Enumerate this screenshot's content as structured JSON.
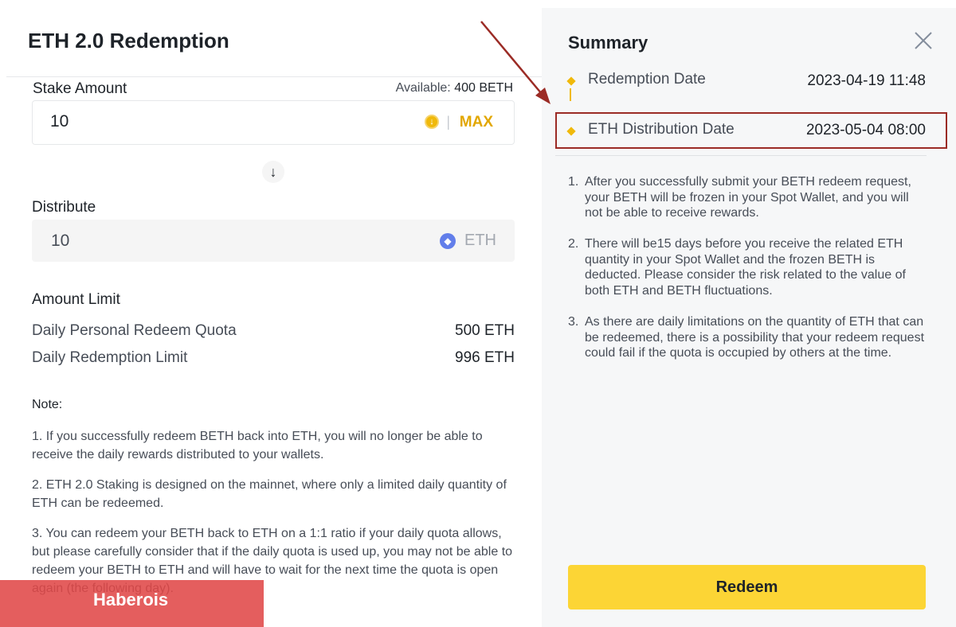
{
  "left": {
    "title": "ETH 2.0 Redemption",
    "stake": {
      "label": "Stake Amount",
      "available_label": "Available:",
      "available_value": "400 BETH",
      "input_value": "10",
      "max_label": "MAX",
      "separator": "|"
    },
    "swap_arrow": "↓",
    "distribute": {
      "label": "Distribute",
      "value": "10",
      "unit": "ETH"
    },
    "amount_limit": {
      "title": "Amount Limit",
      "rows": [
        {
          "label": "Daily Personal Redeem Quota",
          "value": "500 ETH"
        },
        {
          "label": "Daily Redemption Limit",
          "value": "996 ETH"
        }
      ]
    },
    "note": {
      "title": "Note:",
      "items": [
        "1. If you successfully redeem BETH back into ETH, you will no longer be able to receive the daily rewards distributed to your wallets.",
        "2. ETH 2.0 Staking is designed on the mainnet, where only a limited daily quantity of ETH can be redeemed.",
        "3. You can redeem your BETH back to ETH on a 1:1 ratio if your daily quota allows, but please carefully consider that if the daily quota is used up, you may not be able to redeem your BETH to ETH and will have to wait for the next time the quota is open again (the following day)."
      ]
    },
    "watermark": "Haberois"
  },
  "summary": {
    "title": "Summary",
    "timeline": [
      {
        "label": "Redemption Date",
        "value": "2023-04-19 11:48"
      },
      {
        "label": "ETH Distribution Date",
        "value": "2023-05-04 08:00"
      }
    ],
    "items": [
      {
        "num": "1.",
        "text": "After you successfully submit your BETH redeem request, your BETH will be frozen in your Spot Wallet, and you will not be able to receive rewards."
      },
      {
        "num": "2.",
        "text": "There will be15 days before you receive the related ETH quantity in your Spot Wallet and the frozen BETH is deducted. Please consider the risk related to the value of both ETH and BETH fluctuations."
      },
      {
        "num": "3.",
        "text": "As there are daily limitations on the quantity of ETH that can be redeemed, there is a possibility that your redeem request could fail if the quota is occupied by others at the time."
      }
    ],
    "redeem_label": "Redeem"
  },
  "colors": {
    "accent": "#f0b90b",
    "button": "#fcd535",
    "highlight": "#9b2b25",
    "eth": "#627eea"
  }
}
